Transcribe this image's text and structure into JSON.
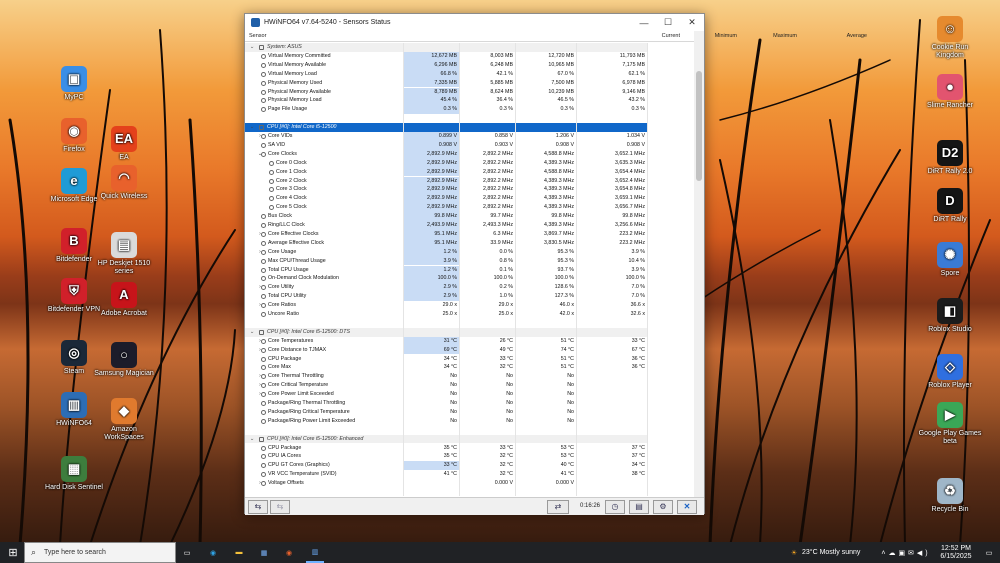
{
  "window": {
    "title": "HWiNFO64 v7.64-5240 - Sensors Status",
    "min": "—",
    "max": "☐",
    "close": "✕"
  },
  "columns": [
    "Sensor",
    "Current",
    "Minimum",
    "Maximum",
    "Average"
  ],
  "rows": [
    {
      "label": "System: ASUS",
      "group": true,
      "indent": 0
    },
    {
      "label": "Virtual Memory Committed",
      "indent": 1,
      "v": [
        "12,672 MB",
        "8,003 MB",
        "12,720 MB",
        "11,793 MB"
      ]
    },
    {
      "label": "Virtual Memory Available",
      "indent": 1,
      "v": [
        "6,296 MB",
        "6,248 MB",
        "10,965 MB",
        "7,175 MB"
      ]
    },
    {
      "label": "Virtual Memory Load",
      "indent": 1,
      "v": [
        "66.8 %",
        "42.1 %",
        "67.0 %",
        "62.1 %"
      ]
    },
    {
      "label": "Physical Memory Used",
      "indent": 1,
      "v": [
        "7,335 MB",
        "5,885 MB",
        "7,500 MB",
        "6,978 MB"
      ]
    },
    {
      "label": "Physical Memory Available",
      "indent": 1,
      "v": [
        "8,789 MB",
        "8,624 MB",
        "10,239 MB",
        "9,146 MB"
      ]
    },
    {
      "label": "Physical Memory Load",
      "indent": 1,
      "v": [
        "45.4 %",
        "36.4 %",
        "46.5 %",
        "43.2 %"
      ]
    },
    {
      "label": "Page File Usage",
      "indent": 1,
      "v": [
        "0.3 %",
        "0.3 %",
        "0.3 %",
        "0.3 %"
      ]
    },
    {
      "label": "",
      "blank": true
    },
    {
      "label": "CPU [#0]: Intel Core i5-12500",
      "group": true,
      "selected": true,
      "indent": 0
    },
    {
      "label": "Core VIDs",
      "indent": 1,
      "exp": "›",
      "v": [
        "0.899 V",
        "0.858 V",
        "1.206 V",
        "1.034 V"
      ]
    },
    {
      "label": "SA VID",
      "indent": 1,
      "v": [
        "0.908 V",
        "0.903 V",
        "0.908 V",
        "0.908 V"
      ]
    },
    {
      "label": "Core Clocks",
      "indent": 1,
      "exp": "⌄",
      "v": [
        "2,892.9 MHz",
        "2,892.2 MHz",
        "4,588.8 MHz",
        "3,652.1 MHz"
      ]
    },
    {
      "label": "Core 0 Clock",
      "indent": 2,
      "v": [
        "2,892.9 MHz",
        "2,892.2 MHz",
        "4,389.3 MHz",
        "3,635.3 MHz"
      ]
    },
    {
      "label": "Core 1 Clock",
      "indent": 2,
      "v": [
        "2,892.9 MHz",
        "2,892.2 MHz",
        "4,588.8 MHz",
        "3,654.4 MHz"
      ]
    },
    {
      "label": "Core 2 Clock",
      "indent": 2,
      "v": [
        "2,892.9 MHz",
        "2,892.2 MHz",
        "4,389.3 MHz",
        "3,652.4 MHz"
      ]
    },
    {
      "label": "Core 3 Clock",
      "indent": 2,
      "v": [
        "2,892.9 MHz",
        "2,892.2 MHz",
        "4,389.3 MHz",
        "3,654.8 MHz"
      ]
    },
    {
      "label": "Core 4 Clock",
      "indent": 2,
      "v": [
        "2,892.9 MHz",
        "2,892.2 MHz",
        "4,389.3 MHz",
        "3,659.1 MHz"
      ]
    },
    {
      "label": "Core 5 Clock",
      "indent": 2,
      "v": [
        "2,892.9 MHz",
        "2,892.2 MHz",
        "4,389.3 MHz",
        "3,656.7 MHz"
      ]
    },
    {
      "label": "Bus Clock",
      "indent": 1,
      "v": [
        "99.8 MHz",
        "99.7 MHz",
        "99.8 MHz",
        "99.8 MHz"
      ]
    },
    {
      "label": "Ring/LLC Clock",
      "indent": 1,
      "v": [
        "2,493.9 MHz",
        "2,493.3 MHz",
        "4,389.3 MHz",
        "3,256.6 MHz"
      ]
    },
    {
      "label": "Core Effective Clocks",
      "indent": 1,
      "exp": "›",
      "v": [
        "95.1 MHz",
        "6.3 MHz",
        "3,869.7 MHz",
        "223.2 MHz"
      ]
    },
    {
      "label": "Average Effective Clock",
      "indent": 1,
      "v": [
        "95.1 MHz",
        "33.9 MHz",
        "3,830.5 MHz",
        "223.2 MHz"
      ]
    },
    {
      "label": "Core Usage",
      "indent": 1,
      "exp": "›",
      "v": [
        "1.2 %",
        "0.0 %",
        "95.3 %",
        "3.9 %"
      ]
    },
    {
      "label": "Max CPU/Thread Usage",
      "indent": 1,
      "v": [
        "3.9 %",
        "0.8 %",
        "95.3 %",
        "10.4 %"
      ]
    },
    {
      "label": "Total CPU Usage",
      "indent": 1,
      "v": [
        "1.2 %",
        "0.1 %",
        "93.7 %",
        "3.9 %"
      ]
    },
    {
      "label": "On-Demand Clock Modulation",
      "indent": 1,
      "v": [
        "100.0 %",
        "100.0 %",
        "100.0 %",
        "100.0 %"
      ]
    },
    {
      "label": "Core Utility",
      "indent": 1,
      "exp": "›",
      "v": [
        "2.9 %",
        "0.2 %",
        "128.6 %",
        "7.0 %"
      ]
    },
    {
      "label": "Total CPU Utility",
      "indent": 1,
      "v": [
        "2.9 %",
        "1.0 %",
        "127.3 %",
        "7.0 %"
      ]
    },
    {
      "label": "Core Ratios",
      "indent": 1,
      "exp": "›",
      "v": [
        "29.0 x",
        "29.0 x",
        "46.0 x",
        "36.6 x"
      ]
    },
    {
      "label": "Uncore Ratio",
      "indent": 1,
      "v": [
        "25.0 x",
        "25.0 x",
        "42.0 x",
        "32.6 x"
      ]
    },
    {
      "label": "",
      "blank": true
    },
    {
      "label": "CPU [#0]: Intel Core i5-12500: DTS",
      "group": true,
      "indent": 0
    },
    {
      "label": "Core Temperatures",
      "indent": 1,
      "exp": "›",
      "v": [
        "31 °C",
        "26 °C",
        "51 °C",
        "33 °C"
      ]
    },
    {
      "label": "Core Distance to TJMAX",
      "indent": 1,
      "exp": "›",
      "v": [
        "69 °C",
        "49 °C",
        "74 °C",
        "67 °C"
      ]
    },
    {
      "label": "CPU Package",
      "indent": 1,
      "v": [
        "34 °C",
        "33 °C",
        "51 °C",
        "36 °C"
      ]
    },
    {
      "label": "Core Max",
      "indent": 1,
      "v": [
        "34 °C",
        "32 °C",
        "51 °C",
        "36 °C"
      ]
    },
    {
      "label": "Core Thermal Throttling",
      "indent": 1,
      "exp": "›",
      "v": [
        "No",
        "No",
        "No",
        ""
      ]
    },
    {
      "label": "Core Critical Temperature",
      "indent": 1,
      "exp": "›",
      "v": [
        "No",
        "No",
        "No",
        ""
      ]
    },
    {
      "label": "Core Power Limit Exceeded",
      "indent": 1,
      "exp": "›",
      "v": [
        "No",
        "No",
        "No",
        ""
      ]
    },
    {
      "label": "Package/Ring Thermal Throttling",
      "indent": 1,
      "v": [
        "No",
        "No",
        "No",
        ""
      ]
    },
    {
      "label": "Package/Ring Critical Temperature",
      "indent": 1,
      "v": [
        "No",
        "No",
        "No",
        ""
      ]
    },
    {
      "label": "Package/Ring Power Limit Exceeded",
      "indent": 1,
      "v": [
        "No",
        "No",
        "No",
        ""
      ]
    },
    {
      "label": "",
      "blank": true
    },
    {
      "label": "CPU [#0]: Intel Core i5-12500: Enhanced",
      "group": true,
      "indent": 0
    },
    {
      "label": "CPU Package",
      "indent": 1,
      "v": [
        "35 °C",
        "33 °C",
        "53 °C",
        "37 °C"
      ]
    },
    {
      "label": "CPU IA Cores",
      "indent": 1,
      "v": [
        "35 °C",
        "32 °C",
        "53 °C",
        "37 °C"
      ]
    },
    {
      "label": "CPU GT Cores (Graphics)",
      "indent": 1,
      "v": [
        "33 °C",
        "32 °C",
        "40 °C",
        "34 °C"
      ]
    },
    {
      "label": "VR VCC Temperature (SVID)",
      "indent": 1,
      "v": [
        "41 °C",
        "32 °C",
        "41 °C",
        "38 °C"
      ]
    },
    {
      "label": "Voltage Offsets",
      "indent": 1,
      "exp": "›",
      "v": [
        "",
        "0.000 V",
        "0.000 V",
        ""
      ]
    }
  ],
  "status": {
    "timer": "0:16:26"
  },
  "desktop_left": [
    {
      "label": "MyPC",
      "color": "#3a8ee6",
      "glyph": "▣"
    },
    {
      "label": "Firefox",
      "color": "#e8612c",
      "glyph": "◉"
    },
    {
      "label": "Microsoft Edge",
      "color": "#1f9bd6",
      "glyph": "e"
    },
    {
      "label": "Bitdefender",
      "color": "#d1202a",
      "glyph": "B"
    },
    {
      "label": "Bitdefender VPN",
      "color": "#d1202a",
      "glyph": "⛨"
    },
    {
      "label": "Steam",
      "color": "#1b2838",
      "glyph": "◎"
    },
    {
      "label": "HWiNFO64",
      "color": "#2d6db5",
      "glyph": "▥"
    },
    {
      "label": "Hard Disk Sentinel",
      "color": "#3d7d3d",
      "glyph": "▦"
    }
  ],
  "desktop_mid": [
    {
      "label": "EA",
      "color": "#e4411b",
      "glyph": "EA"
    },
    {
      "label": "Quick Wireless",
      "color": "#e8612c",
      "glyph": "◠"
    },
    {
      "label": "HP Deskjet 1510 series",
      "color": "#dadada",
      "glyph": "▤"
    },
    {
      "label": "Adobe Acrobat",
      "color": "#c7141a",
      "glyph": "A"
    },
    {
      "label": "Samsung Magician",
      "color": "#1c1c2a",
      "glyph": "○"
    },
    {
      "label": "Amazon WorkSpaces",
      "color": "#e07a2e",
      "glyph": "◆"
    }
  ],
  "desktop_right": [
    {
      "label": "Cookie Run Kingdom",
      "color": "#e68a2e",
      "glyph": "☺"
    },
    {
      "label": "Slime Rancher",
      "color": "#e2546f",
      "glyph": "●"
    },
    {
      "label": "DiRT Rally 2.0",
      "color": "#151515",
      "glyph": "D2"
    },
    {
      "label": "DiRT Rally",
      "color": "#151515",
      "glyph": "D"
    },
    {
      "label": "Spore",
      "color": "#3a7bd5",
      "glyph": "✺"
    },
    {
      "label": "Roblox Studio",
      "color": "#1c1c1c",
      "glyph": "◧"
    },
    {
      "label": "Roblox Player",
      "color": "#2f6fe0",
      "glyph": "◇"
    },
    {
      "label": "Google Play Games beta",
      "color": "#3aa757",
      "glyph": "▶"
    },
    {
      "label": "Recycle Bin",
      "color": "#9fb6c8",
      "glyph": "♻"
    }
  ],
  "taskbar": {
    "search_placeholder": "Type here to search",
    "weather": "23°C  Mostly sunny",
    "time": "12:52 PM",
    "date": "6/15/2025"
  }
}
